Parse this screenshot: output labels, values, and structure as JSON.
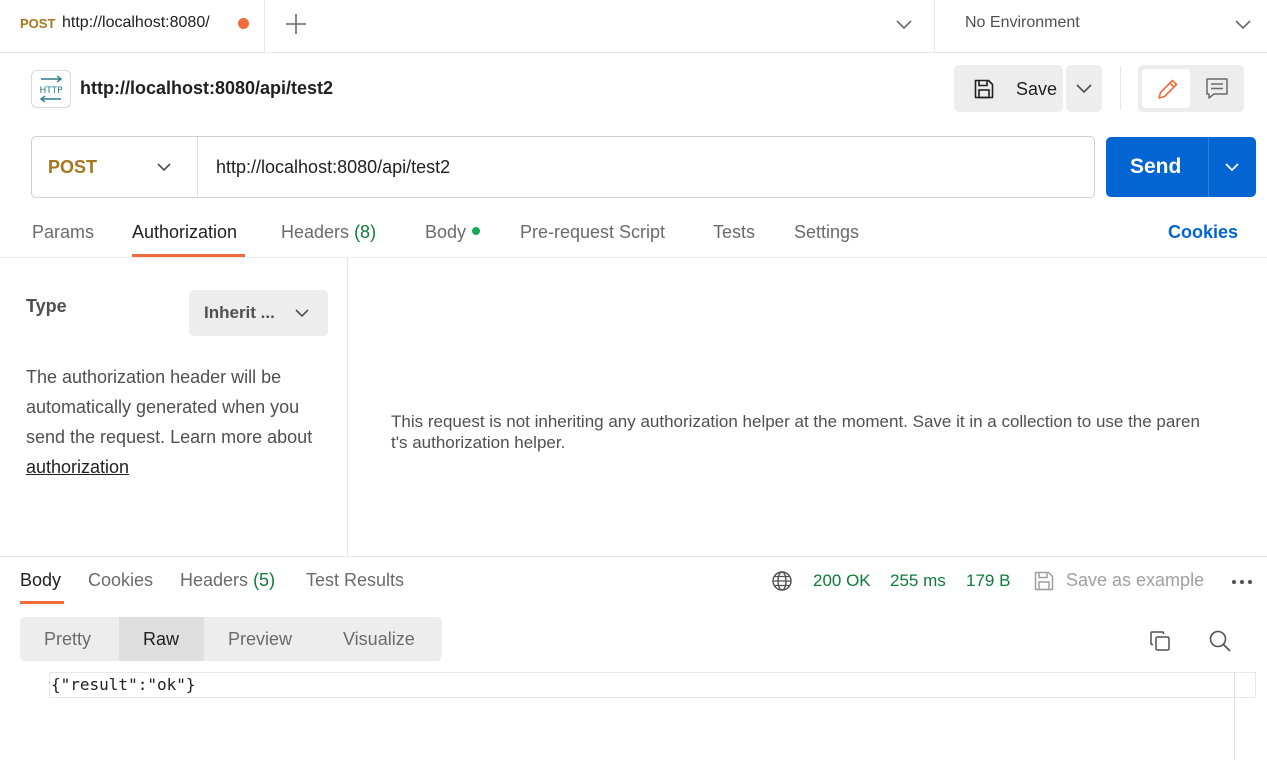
{
  "app": {
    "accent": "#f26b3a",
    "primary": "#0265d2"
  },
  "tabbar": {
    "active_tab": {
      "method": "POST",
      "url": "http://localhost:8080/",
      "unsaved_dot_color": "#f26b3a"
    },
    "new_tab_icon": "plus-icon",
    "environment": "No Environment"
  },
  "request": {
    "icon_label": "HTTP",
    "name": "http://localhost:8080/api/test2",
    "save_label": "Save",
    "method": "POST",
    "url": "http://localhost:8080/api/test2",
    "send_label": "Send"
  },
  "request_tabs": {
    "params": "Params",
    "authorization": "Authorization",
    "headers": "Headers",
    "headers_count": "(8)",
    "body": "Body",
    "prerequest": "Pre-request Script",
    "tests": "Tests",
    "settings": "Settings",
    "cookies": "Cookies",
    "active": "Authorization"
  },
  "auth": {
    "type_label": "Type",
    "type_value": "Inherit ...",
    "description": "The authorization header will be automatically generated when you send the request. Learn more about ",
    "link_text": "authorization",
    "message": "This request is not inheriting any authorization helper at the moment. Save it in a collection to use the parent's authorization helper."
  },
  "response": {
    "tabs": {
      "body": "Body",
      "cookies": "Cookies",
      "headers": "Headers",
      "headers_count": "(5)",
      "test_results": "Test Results",
      "active": "Body"
    },
    "status": "200 OK",
    "time": "255 ms",
    "size": "179 B",
    "save_example": "Save as example",
    "format_tabs": {
      "pretty": "Pretty",
      "raw": "Raw",
      "preview": "Preview",
      "visualize": "Visualize",
      "active": "Raw"
    },
    "body_text": "{\"result\":\"ok\"}"
  }
}
